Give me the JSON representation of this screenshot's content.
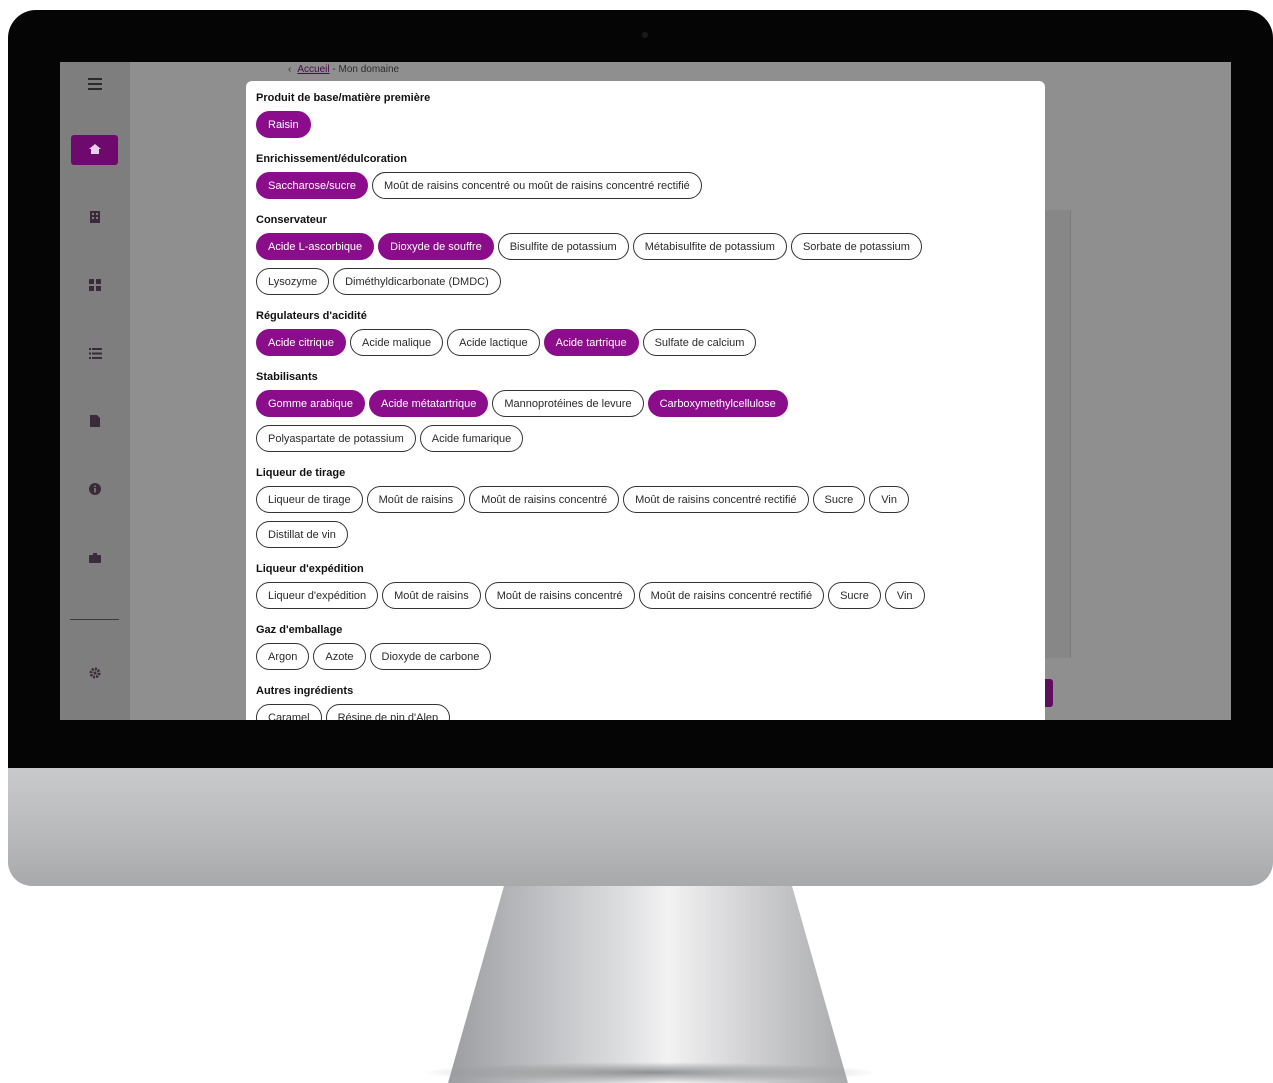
{
  "breadcrumb": {
    "back_icon": "‹",
    "home_link": "Accueil",
    "current": "- Mon domaine"
  },
  "sidebar": {
    "icons": [
      "menu-icon",
      "home-icon",
      "building-icon",
      "grid-icon",
      "list-icon",
      "document-icon",
      "info-icon",
      "briefcase-icon",
      "gear-icon"
    ]
  },
  "colors": {
    "accent": "#8c0d8c",
    "screen_overlay": "#8f8f8f"
  },
  "modal": {
    "sections": [
      {
        "title": "Produit de base/matière première",
        "chips": [
          {
            "label": "Raisin",
            "selected": true
          }
        ]
      },
      {
        "title": "Enrichissement/édulcoration",
        "chips": [
          {
            "label": "Saccharose/sucre",
            "selected": true
          },
          {
            "label": "Moût de raisins concentré ou moût de raisins concentré rectifié",
            "selected": false
          }
        ]
      },
      {
        "title": "Conservateur",
        "chips": [
          {
            "label": "Acide L-ascorbique",
            "selected": true
          },
          {
            "label": "Dioxyde de souffre",
            "selected": true
          },
          {
            "label": "Bisulfite de potassium",
            "selected": false
          },
          {
            "label": "Métabisulfite de potassium",
            "selected": false
          },
          {
            "label": "Sorbate de potassium",
            "selected": false
          },
          {
            "label": "Lysozyme",
            "selected": false
          },
          {
            "label": "Diméthyldicarbonate (DMDC)",
            "selected": false
          }
        ]
      },
      {
        "title": "Régulateurs d'acidité",
        "chips": [
          {
            "label": "Acide citrique",
            "selected": true
          },
          {
            "label": "Acide malique",
            "selected": false
          },
          {
            "label": "Acide lactique",
            "selected": false
          },
          {
            "label": "Acide tartrique",
            "selected": true
          },
          {
            "label": "Sulfate de calcium",
            "selected": false
          }
        ]
      },
      {
        "title": "Stabilisants",
        "chips": [
          {
            "label": "Gomme arabique",
            "selected": true
          },
          {
            "label": "Acide métatartrique",
            "selected": true
          },
          {
            "label": "Mannoprotéines de levure",
            "selected": false
          },
          {
            "label": "Carboxymethylcellulose",
            "selected": true
          },
          {
            "label": "Polyaspartate de potassium",
            "selected": false
          },
          {
            "label": "Acide fumarique",
            "selected": false
          }
        ]
      },
      {
        "title": "Liqueur de tirage",
        "chips": [
          {
            "label": "Liqueur de tirage",
            "selected": false
          },
          {
            "label": "Moût de raisins",
            "selected": false
          },
          {
            "label": "Moût de raisins concentré",
            "selected": false
          },
          {
            "label": "Moût de raisins concentré rectifié",
            "selected": false
          },
          {
            "label": "Sucre",
            "selected": false
          },
          {
            "label": "Vin",
            "selected": false
          },
          {
            "label": "Distillat de vin",
            "selected": false
          }
        ]
      },
      {
        "title": "Liqueur d'expédition",
        "chips": [
          {
            "label": "Liqueur d'expédition",
            "selected": false
          },
          {
            "label": "Moût de raisins",
            "selected": false
          },
          {
            "label": "Moût de raisins concentré",
            "selected": false
          },
          {
            "label": "Moût de raisins concentré rectifié",
            "selected": false
          },
          {
            "label": "Sucre",
            "selected": false
          },
          {
            "label": "Vin",
            "selected": false
          }
        ]
      },
      {
        "title": "Gaz d'emballage",
        "chips": [
          {
            "label": "Argon",
            "selected": false
          },
          {
            "label": "Azote",
            "selected": false
          },
          {
            "label": "Dioxyde de carbone",
            "selected": false
          }
        ]
      },
      {
        "title": "Autres ingrédients",
        "chips": [
          {
            "label": "Caramel",
            "selected": false
          },
          {
            "label": "Résine de pin d'Alep",
            "selected": false
          }
        ]
      }
    ]
  }
}
